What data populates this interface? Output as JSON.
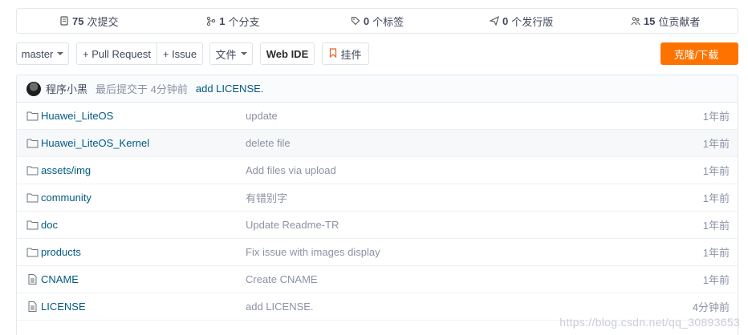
{
  "stats": [
    {
      "count": "75",
      "label": "次提交",
      "icon": "commit-icon"
    },
    {
      "count": "1",
      "label": "个分支",
      "icon": "branch-icon"
    },
    {
      "count": "0",
      "label": "个标签",
      "icon": "tag-icon"
    },
    {
      "count": "0",
      "label": "个发行版",
      "icon": "release-icon"
    },
    {
      "count": "15",
      "label": "位贡献者",
      "icon": "contributors-icon"
    }
  ],
  "toolbar": {
    "branch": "master",
    "pull_request": "+ Pull Request",
    "issue": "+ Issue",
    "files": "文件",
    "web_ide": "Web IDE",
    "widget": "挂件",
    "clone": "克隆/下载"
  },
  "latest_commit": {
    "author": "程序小黑",
    "committed": "最后提交于 4分钟前",
    "message": "add LICENSE."
  },
  "files": [
    {
      "name": "Huawei_LiteOS",
      "type": "folder",
      "message": "update",
      "time": "1年前"
    },
    {
      "name": "Huawei_LiteOS_Kernel",
      "type": "folder",
      "message": "delete file",
      "time": "1年前"
    },
    {
      "name": "assets/img",
      "type": "folder",
      "message": "Add files via upload",
      "time": "1年前"
    },
    {
      "name": "community",
      "type": "folder",
      "message": "有错别字",
      "time": "1年前"
    },
    {
      "name": "doc",
      "type": "folder",
      "message": "Update Readme-TR",
      "time": "1年前"
    },
    {
      "name": "products",
      "type": "folder",
      "message": "Fix issue with images display",
      "time": "1年前"
    },
    {
      "name": "CNAME",
      "type": "file",
      "message": "Create CNAME",
      "time": "1年前"
    },
    {
      "name": "LICENSE",
      "type": "file",
      "message": "add LICENSE.",
      "time": "4分钟前"
    }
  ],
  "watermark": "https://blog.csdn.net/qq_30893653",
  "colors": {
    "accent": "#fe7300",
    "link": "#005980",
    "muted": "#8c92a4"
  }
}
